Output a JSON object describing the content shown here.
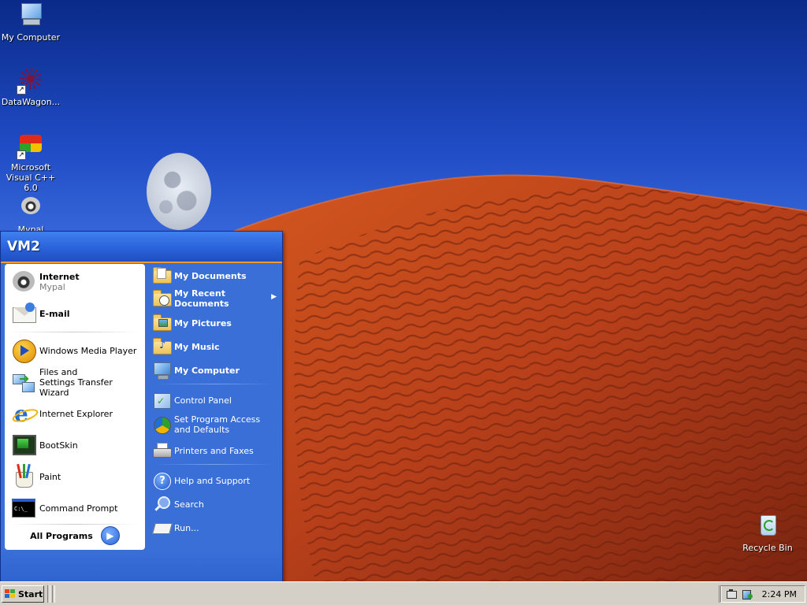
{
  "desktop": {
    "icons": [
      {
        "label": "My Computer",
        "icon": "my-computer-icon"
      },
      {
        "label": "DataWagon...",
        "icon": "datawagon-icon"
      },
      {
        "label": "Microsoft Visual C++ 6.0",
        "icon": "visual-cpp-icon"
      },
      {
        "label": "Mypal",
        "icon": "mypal-icon"
      },
      {
        "label": "Recycle Bin",
        "icon": "recycle-bin-icon"
      }
    ]
  },
  "start_menu": {
    "user": "VM2",
    "pinned": [
      {
        "title": "Internet",
        "subtitle": "Mypal",
        "icon": "mypal-icon"
      },
      {
        "title": "E-mail",
        "icon": "email-icon"
      }
    ],
    "recent": [
      {
        "label": "Windows Media Player",
        "icon": "windows-media-player-icon"
      },
      {
        "label": "Files and Settings Transfer Wizard",
        "icon": "transfer-wizard-icon"
      },
      {
        "label": "Internet Explorer",
        "icon": "internet-explorer-icon"
      },
      {
        "label": "BootSkin",
        "icon": "bootskin-icon"
      },
      {
        "label": "Paint",
        "icon": "paint-icon"
      },
      {
        "label": "Command Prompt",
        "icon": "command-prompt-icon"
      }
    ],
    "all_programs": "All Programs",
    "places": [
      {
        "label": "My Documents",
        "icon": "my-documents-icon"
      },
      {
        "label": "My Recent Documents",
        "icon": "recent-documents-icon"
      },
      {
        "label": "My Pictures",
        "icon": "my-pictures-icon"
      },
      {
        "label": "My Music",
        "icon": "my-music-icon"
      },
      {
        "label": "My Computer",
        "icon": "my-computer-icon"
      }
    ],
    "system": [
      {
        "label": "Control Panel",
        "icon": "control-panel-icon"
      },
      {
        "label": "Set Program Access and Defaults",
        "icon": "program-access-icon"
      },
      {
        "label": "Printers and Faxes",
        "icon": "printer-icon"
      }
    ],
    "help": [
      {
        "label": "Help and Support",
        "icon": "help-icon"
      },
      {
        "label": "Search",
        "icon": "search-icon"
      },
      {
        "label": "Run...",
        "icon": "run-icon"
      }
    ]
  },
  "taskbar": {
    "start_label": "Start",
    "clock": "2:24 PM",
    "tray_icons": [
      "network-icon",
      "volume-icon"
    ]
  },
  "colors": {
    "start_menu_blue": "#3a6fd8",
    "taskbar_gray": "#d4d0c8",
    "desert_red": "#b8401a",
    "sky_blue": "#1f4bc4"
  }
}
